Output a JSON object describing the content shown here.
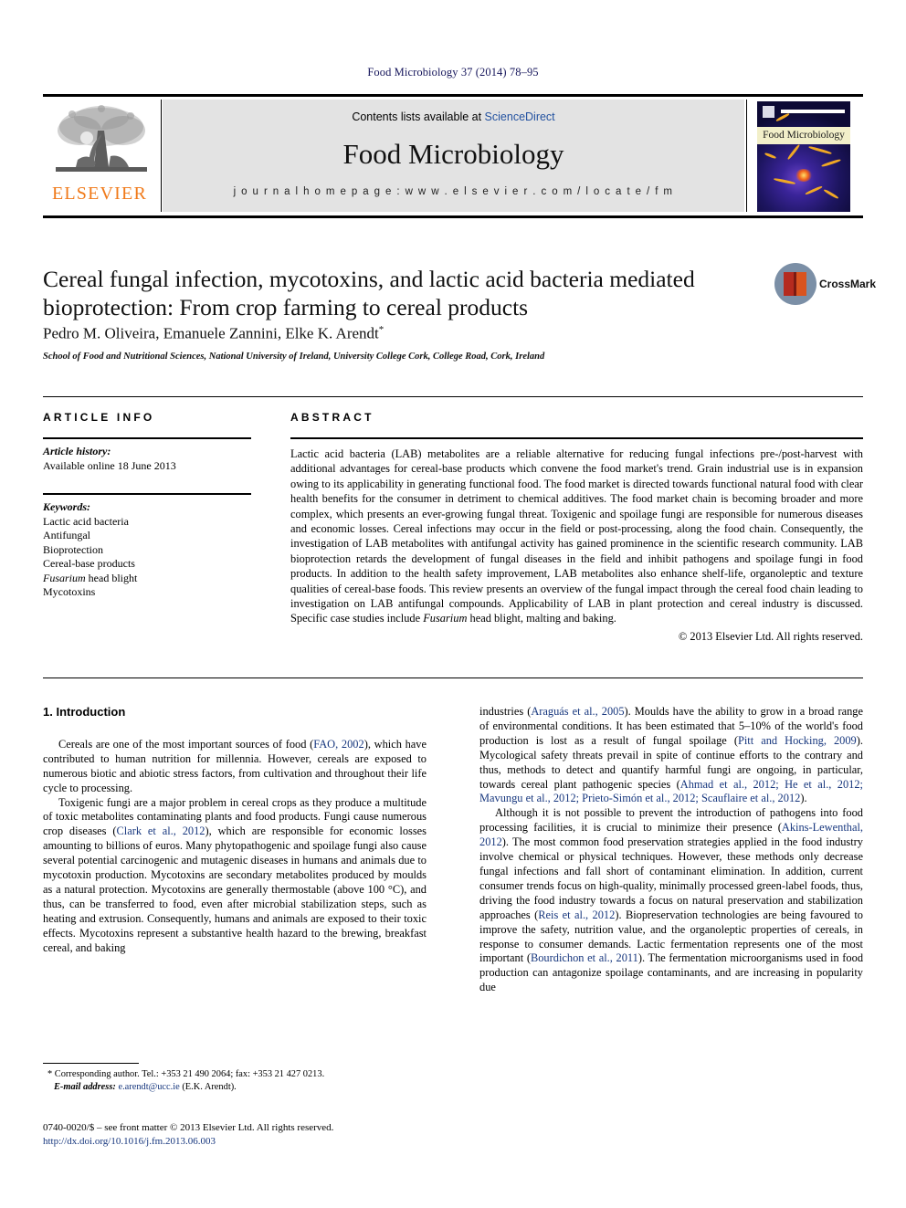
{
  "running_head": "Food Microbiology 37 (2014) 78–95",
  "masthead": {
    "contents_prefix": "Contents lists available at ",
    "sciencedirect": "ScienceDirect",
    "journal_name": "Food Microbiology",
    "homepage": "j o u r n a l   h o m e p a g e :   w w w . e l s e v i e r . c o m / l o c a t e / f m",
    "publisher_logo_text": "ELSEVIER",
    "cover_title": "Food Microbiology"
  },
  "article": {
    "title": "Cereal fungal infection, mycotoxins, and lactic acid bacteria mediated bioprotection: From crop farming to cereal products",
    "authors": "Pedro M. Oliveira, Emanuele Zannini, Elke K. Arendt",
    "corresponding_marker": "*",
    "affiliation": "School of Food and Nutritional Sciences, National University of Ireland, University College Cork, College Road, Cork, Ireland",
    "crossmark_label": "CrossMark"
  },
  "article_info": {
    "heading": "ARTICLE INFO",
    "history_label": "Article history:",
    "history_value": "Available online 18 June 2013",
    "keywords_label": "Keywords:",
    "keywords": [
      "Lactic acid bacteria",
      "Antifungal",
      "Bioprotection",
      "Cereal-base products",
      "Fusarium head blight",
      "Mycotoxins"
    ],
    "keyword_italic_index": 4,
    "keyword_italic_word": "Fusarium",
    "keyword_italic_rest": " head blight"
  },
  "abstract": {
    "heading": "ABSTRACT",
    "body_part1": "Lactic acid bacteria (LAB) metabolites are a reliable alternative for reducing fungal infections pre-/post-harvest with additional advantages for cereal-base products which convene the food market's trend. Grain industrial use is in expansion owing to its applicability in generating functional food. The food market is directed towards functional natural food with clear health benefits for the consumer in detriment to chemical additives. The food market chain is becoming broader and more complex, which presents an ever-growing fungal threat. Toxigenic and spoilage fungi are responsible for numerous diseases and economic losses. Cereal infections may occur in the field or post-processing, along the food chain. Consequently, the investigation of LAB metabolites with antifungal activity has gained prominence in the scientific research community. LAB bioprotection retards the development of fungal diseases in the field and inhibit pathogens and spoilage fungi in food products. In addition to the health safety improvement, LAB metabolites also enhance shelf-life, organoleptic and texture qualities of cereal-base foods. This review presents an overview of the fungal impact through the cereal food chain leading to investigation on LAB antifungal compounds. Applicability of LAB in plant protection and cereal industry is discussed. Specific case studies include ",
    "body_italic": "Fusarium",
    "body_part2": " head blight, malting and baking.",
    "copyright": "© 2013 Elsevier Ltd. All rights reserved."
  },
  "intro": {
    "heading": "1. Introduction",
    "left_p1_a": "Cereals are one of the most important sources of food (",
    "left_p1_ref1": "FAO, 2002",
    "left_p1_b": "), which have contributed to human nutrition for millennia. However, cereals are exposed to numerous biotic and abiotic stress factors, from cultivation and throughout their life cycle to processing.",
    "left_p2_a": "Toxigenic fungi are a major problem in cereal crops as they produce a multitude of toxic metabolites contaminating plants and food products. Fungi cause numerous crop diseases (",
    "left_p2_ref1": "Clark et al., 2012",
    "left_p2_b": "), which are responsible for economic losses amounting to billions of euros. Many phytopathogenic and spoilage fungi also cause several potential carcinogenic and mutagenic diseases in humans and animals due to mycotoxin production. Mycotoxins are secondary metabolites produced by moulds as a natural protection. Mycotoxins are generally thermostable (above 100 °C), and thus, can be transferred to food, even after microbial stabilization steps, such as heating and extrusion. Consequently, humans and animals are exposed to their toxic effects. Mycotoxins represent a substantive health hazard to the brewing, breakfast cereal, and baking",
    "right_p1_a": "industries (",
    "right_p1_ref1": "Araguás et al., 2005",
    "right_p1_b": "). Moulds have the ability to grow in a broad range of environmental conditions. It has been estimated that 5–10% of the world's food production is lost as a result of fungal spoilage (",
    "right_p1_ref2": "Pitt and Hocking, 2009",
    "right_p1_c": "). Mycological safety threats prevail in spite of continue efforts to the contrary and thus, methods to detect and quantify harmful fungi are ongoing, in particular, towards cereal plant pathogenic species (",
    "right_p1_ref3": "Ahmad et al., 2012; He et al., 2012; Mavungu et al., 2012; Prieto-Simón et al., 2012; Scauflaire et al., 2012",
    "right_p1_d": ").",
    "right_p2_a": "Although it is not possible to prevent the introduction of pathogens into food processing facilities, it is crucial to minimize their presence (",
    "right_p2_ref1": "Akins-Lewenthal, 2012",
    "right_p2_b": "). The most common food preservation strategies applied in the food industry involve chemical or physical techniques. However, these methods only decrease fungal infections and fall short of contaminant elimination. In addition, current consumer trends focus on high-quality, minimally processed green-label foods, thus, driving the food industry towards a focus on natural preservation and stabilization approaches (",
    "right_p2_ref2": "Reis et al., 2012",
    "right_p2_c": "). Biopreservation technologies are being favoured to improve the safety, nutrition value, and the organoleptic properties of cereals, in response to consumer demands. Lactic fermentation represents one of the most important (",
    "right_p2_ref3": "Bourdichon et al., 2011",
    "right_p2_d": "). The fermentation microorganisms used in food production can antagonize spoilage contaminants, and are increasing in popularity due"
  },
  "footnote": {
    "marker": "*",
    "corresponding": " Corresponding author. Tel.: +353 21 490 2064; fax: +353 21 427 0213.",
    "email_label": "E-mail address:",
    "email": "e.arendt@ucc.ie",
    "email_suffix": " (E.K. Arendt)."
  },
  "footer": {
    "issn_line": "0740-0020/$ – see front matter © 2013 Elsevier Ltd. All rights reserved.",
    "doi": "http://dx.doi.org/10.1016/j.fm.2013.06.003"
  },
  "colors": {
    "running_head": "#17175c",
    "citation": "#17377e",
    "sciencedirect": "#2352a0",
    "elsevier_orange": "#f07a1a",
    "panel_gray": "#e3e3e3"
  }
}
